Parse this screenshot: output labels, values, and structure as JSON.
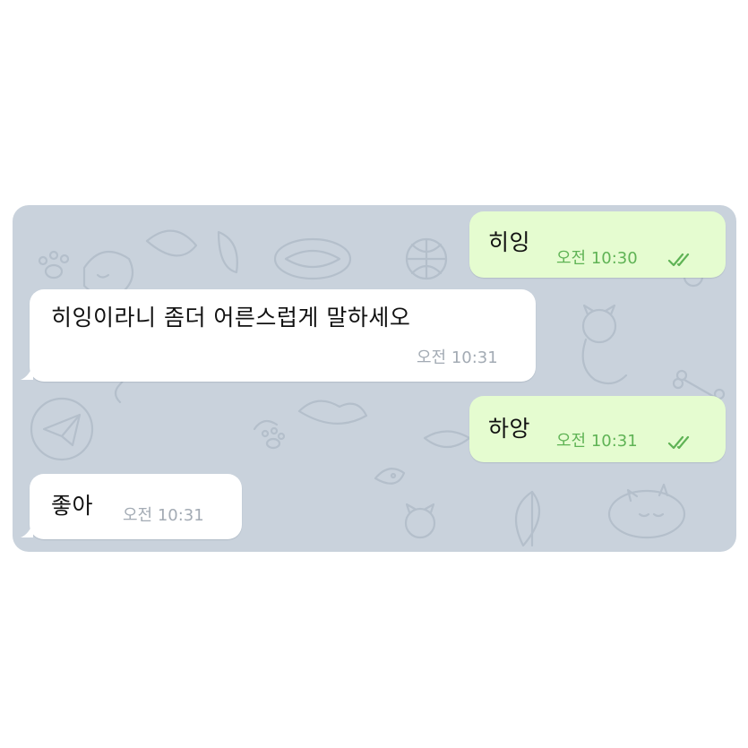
{
  "messages": [
    {
      "direction": "outgoing",
      "text": "히잉",
      "time": "오전 10:30",
      "status": "read"
    },
    {
      "direction": "incoming",
      "text": "히잉이라니 좀더 어른스럽게 말하세오",
      "time": "오전 10:31"
    },
    {
      "direction": "outgoing",
      "text": "하앙",
      "time": "오전 10:31",
      "status": "read"
    },
    {
      "direction": "incoming",
      "text": "좋아",
      "time": "오전 10:31"
    }
  ],
  "colors": {
    "outgoing_bubble": "#e5fcd0",
    "incoming_bubble": "#ffffff",
    "background": "#c9d2dc",
    "time_outgoing": "#5fb355",
    "time_incoming": "#a3abb4"
  },
  "icons": {
    "read_status": "double-check-icon",
    "wallpaper": "doodle-pattern"
  }
}
